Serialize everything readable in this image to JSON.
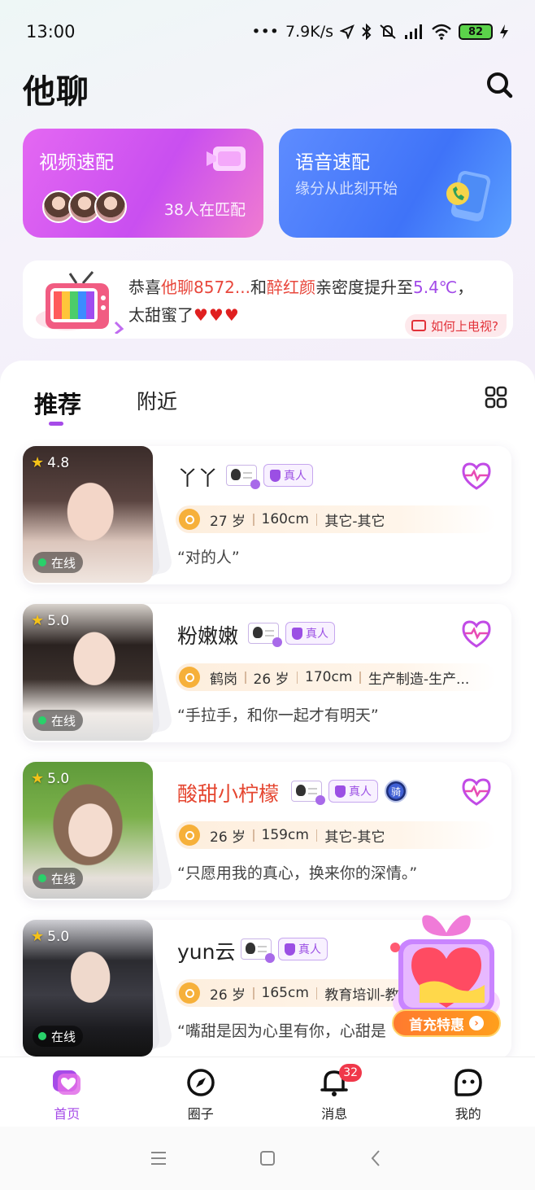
{
  "status_bar": {
    "time": "13:00",
    "network_speed": "7.9K/s",
    "battery": "82"
  },
  "app": {
    "title": "他聊"
  },
  "match": {
    "video": {
      "title": "视频速配",
      "count_text": "38人在匹配"
    },
    "voice": {
      "title": "语音速配",
      "subtitle": "缘分从此刻开始"
    }
  },
  "banner": {
    "prefix": "恭喜",
    "user1": "他聊8572...",
    "and": "和",
    "user2": "醉红颜",
    "middle": "亲密度提升至",
    "value": "5.4℃",
    "suffix": "，",
    "line2": "太甜蜜了",
    "hearts": "♥♥♥",
    "how_btn": "如何上电视?"
  },
  "tabs": [
    {
      "label": "推荐"
    },
    {
      "label": "附近"
    }
  ],
  "badges": {
    "real": "真人",
    "rider": "骑"
  },
  "users": [
    {
      "rating": "4.8",
      "online": "在线",
      "name": "丫丫",
      "info": [
        "27 岁",
        "160cm",
        "其它-其它"
      ],
      "quote": "“对的人”"
    },
    {
      "rating": "5.0",
      "online": "在线",
      "name": "粉嫩嫩",
      "info": [
        "鹤岗",
        "26 岁",
        "170cm",
        "生产制造-生产..."
      ],
      "quote": "“手拉手，和你一起才有明天”"
    },
    {
      "rating": "5.0",
      "online": "在线",
      "name": "酸甜小柠檬",
      "info": [
        "26 岁",
        "159cm",
        "其它-其它"
      ],
      "quote": "“只愿用我的真心，换来你的深情。”"
    },
    {
      "rating": "5.0",
      "online": "在线",
      "name": "yun云",
      "info": [
        "26 岁",
        "165cm",
        "教育培训-教"
      ],
      "quote": "“嘴甜是因为心里有你，心甜是"
    }
  ],
  "promo": {
    "label": "首充特惠"
  },
  "nav": [
    {
      "label": "首页"
    },
    {
      "label": "圈子"
    },
    {
      "label": "消息",
      "badge": "32"
    },
    {
      "label": "我的"
    }
  ],
  "colors": {
    "accent": "#a64be8",
    "red": "#e8473c",
    "badge": "#f0384a"
  }
}
